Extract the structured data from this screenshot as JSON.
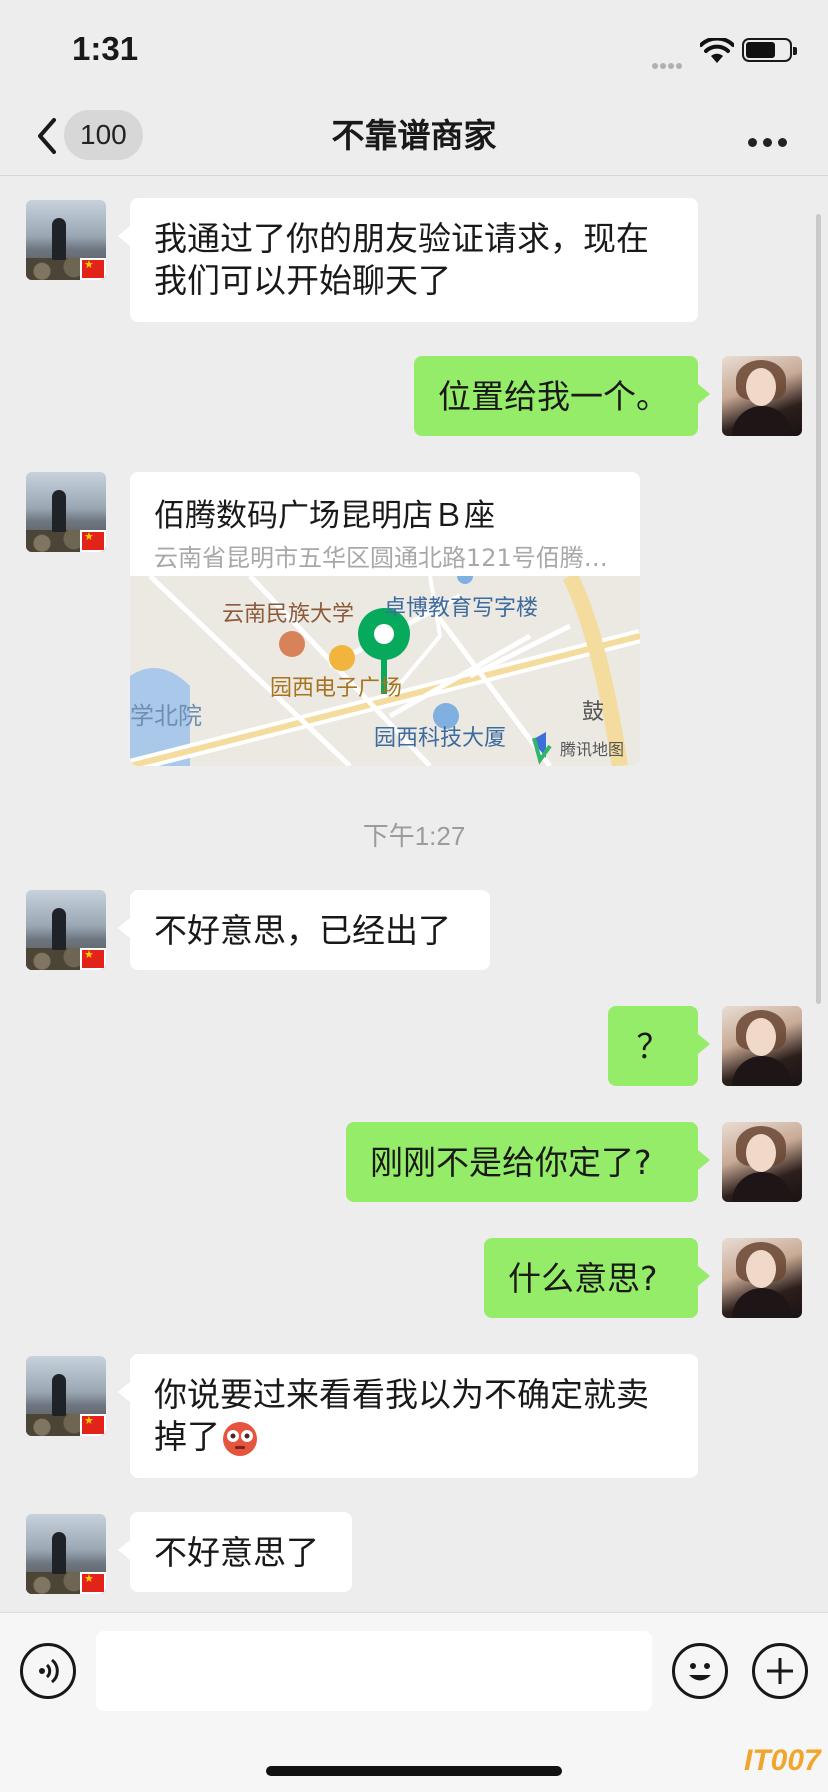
{
  "status_bar": {
    "time": "1:31",
    "signal_icon": "signal-dots-icon",
    "wifi_icon": "wifi-icon",
    "battery_icon": "battery-icon"
  },
  "nav": {
    "back_icon": "chevron-left-icon",
    "unread_count": "100",
    "title": "不靠谱商家",
    "more_icon": "more-dots-icon"
  },
  "messages": [
    {
      "sender": "merchant",
      "text": "我通过了你的朋友验证请求，现在我们可以开始聊天了"
    },
    {
      "sender": "me",
      "text": "位置给我一个。"
    },
    {
      "sender": "merchant",
      "type": "location",
      "name": "佰腾数码广场昆明店Ｂ座",
      "address": "云南省昆明市五华区圆通北路121号佰腾…",
      "map_labels": [
        "云南民族大学",
        "卓博教育写字楼",
        "园西电子广场",
        "学北院",
        "园西科技大厦",
        "鼓",
        "腾讯地图"
      ]
    },
    {
      "type": "time",
      "text": "下午1:27"
    },
    {
      "sender": "merchant",
      "text": "不好意思，已经出了"
    },
    {
      "sender": "me",
      "text": "？"
    },
    {
      "sender": "me",
      "text": "刚刚不是给你定了?"
    },
    {
      "sender": "me",
      "text": "什么意思?"
    },
    {
      "sender": "merchant",
      "text": "你说要过来看看我以为不确定就卖掉了",
      "emoji": "flushed-face-emoji"
    },
    {
      "sender": "merchant",
      "text": "不好意思了"
    }
  ],
  "input_bar": {
    "voice_icon": "voice-icon",
    "text_value": "",
    "emoji_icon": "smiley-icon",
    "plus_icon": "plus-icon"
  },
  "watermark": "IT007"
}
